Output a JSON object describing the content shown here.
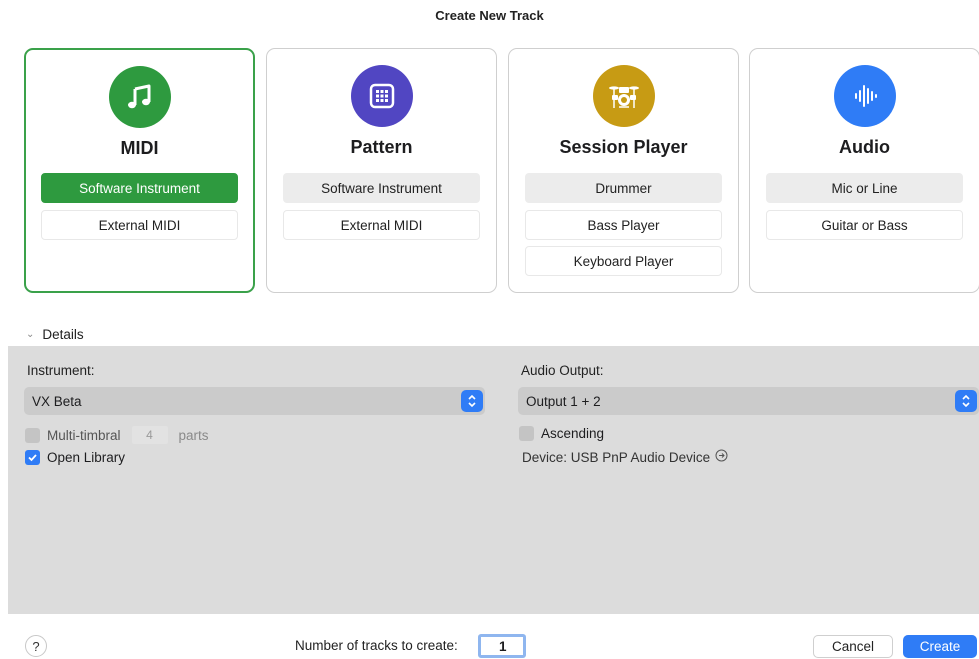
{
  "dialog": {
    "title": "Create New Track"
  },
  "cards": [
    {
      "title": "MIDI",
      "icon": "music-note-icon",
      "color": "#2e9a3f",
      "options": [
        "Software Instrument",
        "External MIDI"
      ]
    },
    {
      "title": "Pattern",
      "icon": "grid-keypad-icon",
      "color": "#5146c2",
      "options": [
        "Software Instrument",
        "External MIDI"
      ]
    },
    {
      "title": "Session Player",
      "icon": "drum-kit-icon",
      "color": "#c79b14",
      "options": [
        "Drummer",
        "Bass Player",
        "Keyboard Player"
      ]
    },
    {
      "title": "Audio",
      "icon": "waveform-icon",
      "color": "#2f7cf6",
      "options": [
        "Mic or Line",
        "Guitar or Bass"
      ]
    }
  ],
  "details": {
    "toggle_label": "Details",
    "instrument_label": "Instrument:",
    "instrument_value": "VX Beta",
    "multitimbral_label": "Multi-timbral",
    "parts_value": "4",
    "parts_label": "parts",
    "open_library_label": "Open Library",
    "audio_output_label": "Audio Output:",
    "audio_output_value": "Output 1 + 2",
    "ascending_label": "Ascending",
    "device_label": "Device: USB PnP Audio Device"
  },
  "footer": {
    "help_label": "?",
    "count_label": "Number of tracks to create:",
    "count_value": "1",
    "cancel_label": "Cancel",
    "create_label": "Create"
  }
}
